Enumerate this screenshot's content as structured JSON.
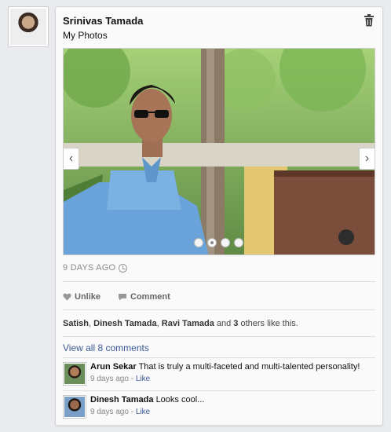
{
  "post": {
    "author": "Srinivas Tamada",
    "subtitle": "My Photos",
    "timestamp": "9 DAYS AGO",
    "slides_total": 4,
    "active_slide": 2
  },
  "actions": {
    "unlike_label": "Unlike",
    "comment_label": "Comment"
  },
  "likes": {
    "names": [
      "Satish",
      "Dinesh Tamada",
      "Ravi Tamada"
    ],
    "sep_comma": ", ",
    "sep_and": " and ",
    "others_count": "3",
    "others_suffix": " others like this."
  },
  "view_all_label": "View all 8 comments",
  "comments": [
    {
      "author": "Arun Sekar",
      "text": "That is truly a multi-faceted and multi-talented personality!",
      "time": "9 days ago",
      "dash": " - ",
      "like": "Like"
    },
    {
      "author": "Dinesh Tamada",
      "text": "Looks cool...",
      "time": "9 days ago",
      "dash": " - ",
      "like": "Like"
    }
  ],
  "icons": {
    "trash": "trash-icon",
    "heart": "heart-icon",
    "comment": "comment-bubble-icon",
    "clock": "clock-icon",
    "prev": "chevron-left-icon",
    "next": "chevron-right-icon"
  },
  "colors": {
    "link": "#3b5998",
    "muted": "#8a8a8a",
    "background": "#e9ebee",
    "card": "#fafafa"
  }
}
